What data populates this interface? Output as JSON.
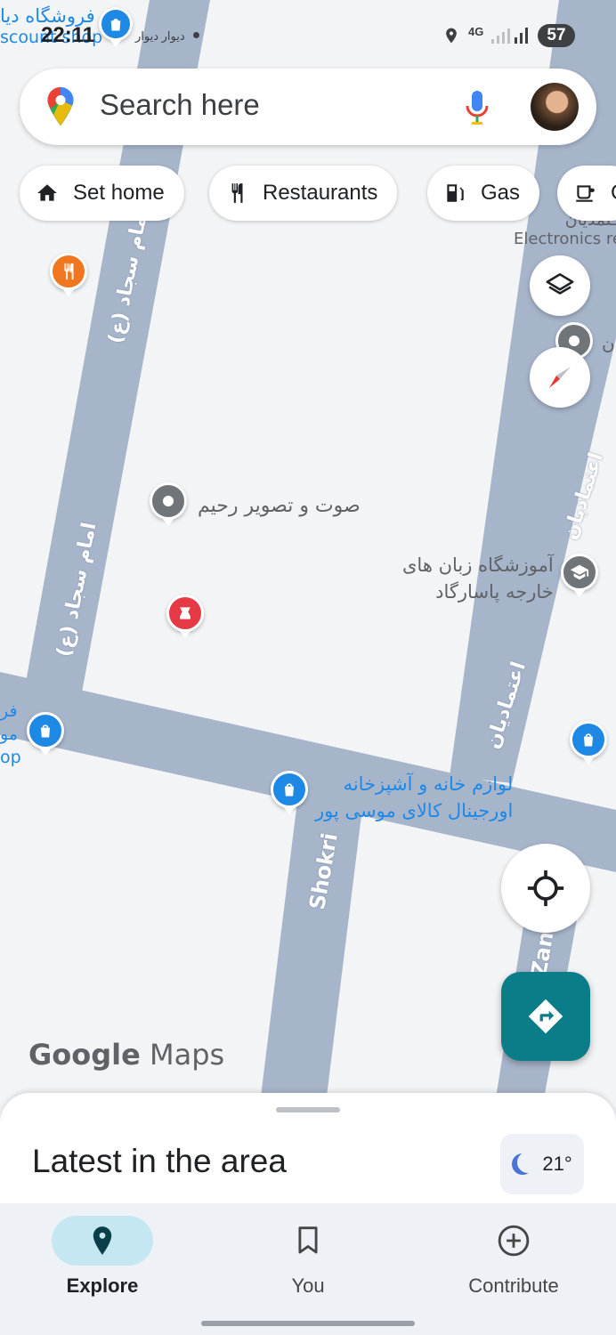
{
  "status_bar": {
    "time": "22:11",
    "notif_text": "دیوار دیوار",
    "network": "4G",
    "battery": "57"
  },
  "search": {
    "placeholder": "Search here",
    "mic_icon": "mic-icon",
    "avatar": "profile-avatar"
  },
  "chips": [
    {
      "label": "Set home",
      "icon": "home-icon"
    },
    {
      "label": "Restaurants",
      "icon": "restaurant-icon"
    },
    {
      "label": "Gas",
      "icon": "gas-station-icon"
    },
    {
      "label": "C",
      "icon": "cafe-icon"
    }
  ],
  "map": {
    "streets": {
      "imam_sajjad_top": "امام سجاد (ع)",
      "imam_sajjad_bottom": "امام سجاد (ع)",
      "etemadian_top": "اعتمادیان",
      "etemadian_bottom": "اعتمادیان",
      "shokri": "Shokri",
      "zand": "Zan"
    },
    "places": {
      "discount_shop_line1": "فروشگاه دیا",
      "discount_shop_line2": "scount shop",
      "electronics_fa": "ـتمدیان",
      "electronics_en": "Electronics rep",
      "sound_image": "صوت و تصویر رحیم",
      "language_school_line1": "آموزشگاه زبان های",
      "language_school_line2": "خارجه پاسارگاد",
      "home_kitchen_line1": "لوازم خانه و آشپزخانه",
      "home_kitchen_line2": "اورجینال کالای موسی پور",
      "left_shop_line1": "فر",
      "left_shop_line2": "مو",
      "left_shop_line3": "op",
      "right_edge_text": "ن"
    },
    "brand_text": {
      "google": "Google",
      "maps": "Maps"
    }
  },
  "sheet": {
    "title": "Latest in the area",
    "temperature": "21°"
  },
  "nav": [
    {
      "label": "Explore",
      "icon": "explore-pin-icon",
      "active": true
    },
    {
      "label": "You",
      "icon": "bookmark-icon",
      "active": false
    },
    {
      "label": "Contribute",
      "icon": "add-circle-icon",
      "active": false
    }
  ],
  "colors": {
    "road": "#a7b5cb",
    "teal_fab": "#0b7d88",
    "poi_blue": "#1e88e5",
    "explore_pill": "#c5e7f2"
  }
}
